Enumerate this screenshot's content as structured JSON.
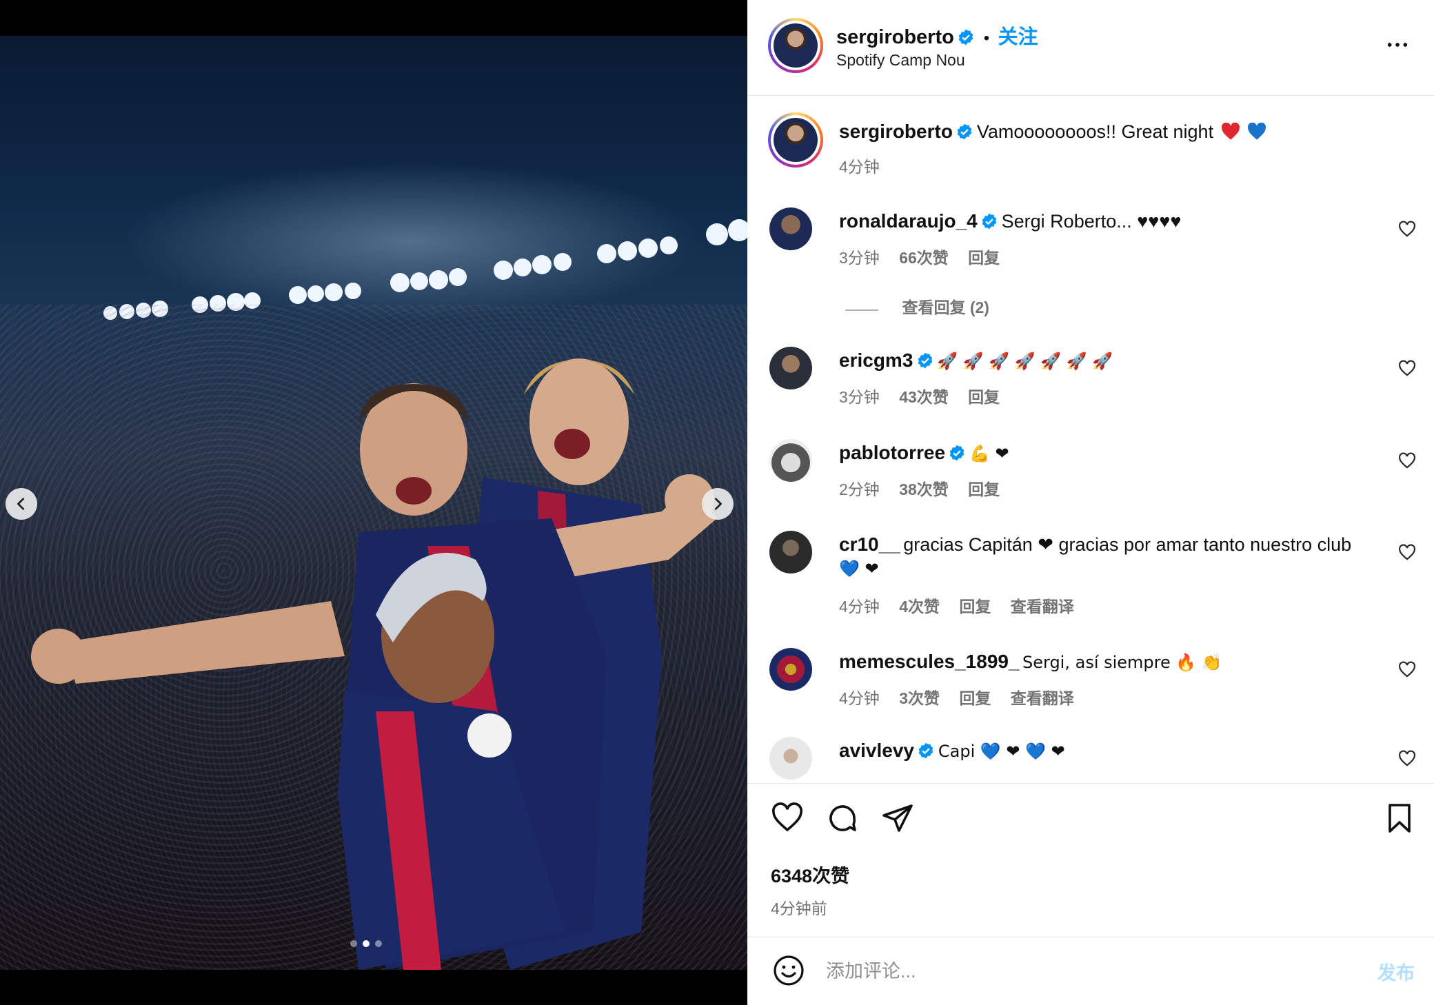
{
  "post": {
    "author": "sergiroberto",
    "follow_label": "关注",
    "dot": "•",
    "location": "Spotify Camp Nou",
    "caption": "Vamoooooooos!! Great night",
    "caption_emojis": [
      "red-heart",
      "blue-heart"
    ],
    "caption_time": "4分钟",
    "likes": "6348次赞",
    "posted_ago": "4分钟前"
  },
  "comments": [
    {
      "user": "ronaldaraujo_4",
      "verified": true,
      "text": "Sergi Roberto... ♥♥♥♥",
      "time": "3分钟",
      "likes": "66次赞",
      "reply": "回复"
    },
    {
      "user": "ericgm3",
      "verified": true,
      "text": "🚀 🚀 🚀 🚀 🚀 🚀 🚀",
      "time": "3分钟",
      "likes": "43次赞",
      "reply": "回复"
    },
    {
      "user": "pablotorree",
      "verified": true,
      "text": "💪 ❤",
      "time": "2分钟",
      "likes": "38次赞",
      "reply": "回复"
    },
    {
      "user": "cr10__",
      "verified": false,
      "text": "gracias Capitán ❤ gracias por amar tanto nuestro club",
      "text2": "💙 ❤",
      "time": "4分钟",
      "likes": "4次赞",
      "reply": "回复",
      "translate": "查看翻译"
    },
    {
      "user": "memescules_1899_",
      "verified": false,
      "text": "Sergi, así siempre 🔥 👏",
      "time": "4分钟",
      "likes": "3次赞",
      "reply": "回复",
      "translate": "查看翻译"
    },
    {
      "user": "avivlevy",
      "verified": true,
      "text": "Capi 💙 ❤ 💙 ❤"
    }
  ],
  "view_replies": "查看回复 (2)",
  "composer": {
    "placeholder": "添加评论...",
    "post_label": "发布"
  },
  "colors": {
    "accent": "#0095f6",
    "muted": "#737373",
    "post_disabled": "#b2dffc"
  }
}
